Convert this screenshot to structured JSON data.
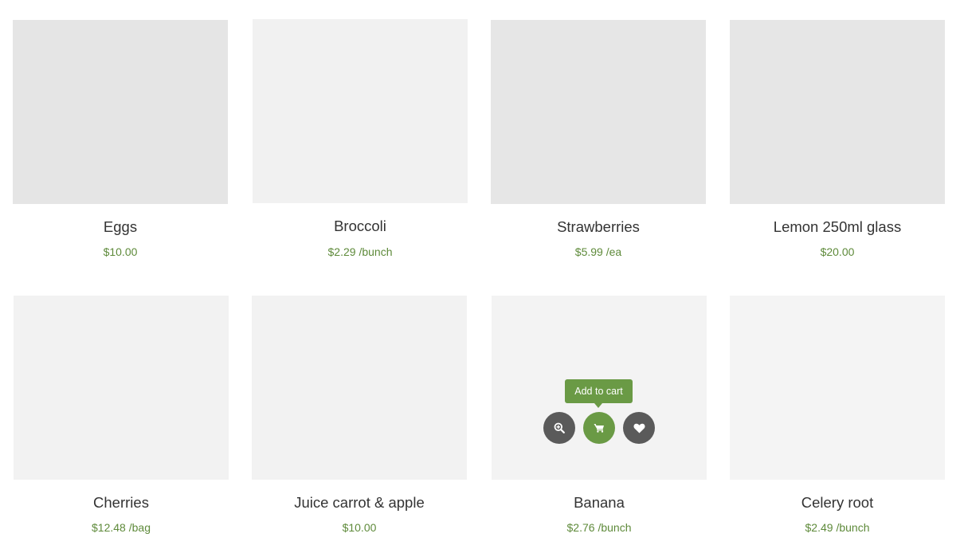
{
  "products": [
    {
      "name": "Eggs",
      "price": "$10.00",
      "image_color": "#e5e5e5"
    },
    {
      "name": "Broccoli",
      "price": "$2.29 /bunch",
      "image_color": "#f1f1f1"
    },
    {
      "name": "Strawberries",
      "price": "$5.99 /ea",
      "image_color": "#e6e6e6"
    },
    {
      "name": "Lemon 250ml glass",
      "price": "$20.00",
      "image_color": "#e6e6e6"
    },
    {
      "name": "Cherries",
      "price": "$12.48 /bag",
      "image_color": "#f2f2f2"
    },
    {
      "name": "Juice carrot & apple",
      "price": "$10.00",
      "image_color": "#f2f2f2"
    },
    {
      "name": "Banana",
      "price": "$2.76 /bunch",
      "image_color": "#f3f3f3"
    },
    {
      "name": "Celery root",
      "price": "$2.49 /bunch",
      "image_color": "#f4f4f4"
    }
  ],
  "hover_actions": {
    "tooltip": "Add to cart",
    "icons": [
      "zoom-in-icon",
      "cart-icon",
      "heart-icon"
    ]
  },
  "colors": {
    "accent": "#6a9a45",
    "price": "#5e8a3a",
    "action_button": "#5a5a5a"
  }
}
